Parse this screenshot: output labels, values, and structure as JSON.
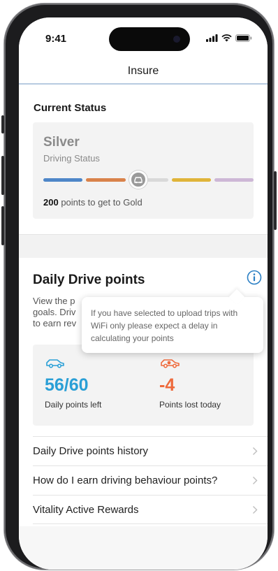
{
  "status_bar": {
    "time": "9:41"
  },
  "nav": {
    "title": "Insure"
  },
  "current_status": {
    "heading": "Current Status",
    "tier": "Silver",
    "tier_caption": "Driving Status",
    "points_needed": "200",
    "points_text": " points to get to Gold",
    "progress_colors": [
      "#4e86c8",
      "#d9824a",
      "#9a9a9a",
      "#e0b43a",
      "#cdb7d6"
    ]
  },
  "daily_drive": {
    "heading": "Daily Drive points",
    "desc_lines": [
      "View the p",
      "goals. Driv",
      "to earn rev"
    ],
    "tooltip": "If you have selected to upload trips with WiFi only please expect a delay in calculating your points",
    "left": {
      "value": "56/60",
      "label": "Daily points left",
      "color": "#2a9fd6"
    },
    "lost": {
      "value": "-4",
      "label": "Points lost today",
      "color": "#ee6a3c"
    }
  },
  "links": [
    {
      "label": "Daily Drive points history"
    },
    {
      "label": "How do I earn driving behaviour points?"
    },
    {
      "label": "Vitality Active Rewards"
    }
  ],
  "colors": {
    "accent_blue": "#2a7fc4",
    "divider_blue": "#b7cbe0"
  }
}
